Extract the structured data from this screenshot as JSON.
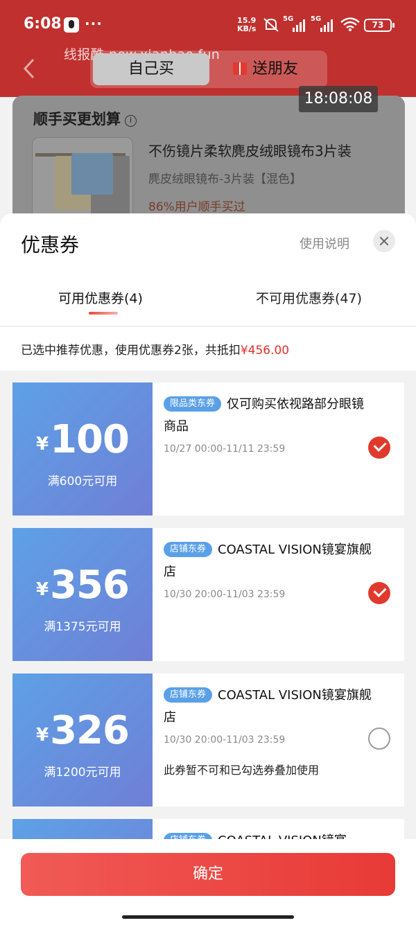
{
  "status_bar": {
    "time": "6:08",
    "more": "···",
    "net_speed_value": "15.9",
    "net_speed_unit": "KB/s",
    "sim1": "5G",
    "sim2": "5G",
    "battery": "73"
  },
  "watermark": "线报酷-new.xianbao.fun",
  "overlay_time": "18:08:08",
  "header": {
    "buy_self": "自己买",
    "send_friend": "送朋友"
  },
  "bg_card": {
    "title": "顺手买更划算",
    "info": "i",
    "product_name": "不伤镜片柔软麂皮绒眼镜布3片装",
    "product_variant": "麂皮绒眼镜布-3片装【混色】",
    "product_stat": "86%用户顺手买过"
  },
  "sheet": {
    "title": "优惠券",
    "usage_link": "使用说明",
    "tab_available": "可用优惠券(4)",
    "tab_unavailable": "不可用优惠券(47)",
    "summary_prefix": "已选中推荐优惠，使用优惠券2张，共抵扣",
    "summary_amount": "¥456.00"
  },
  "coupons": [
    {
      "yen": "¥",
      "amount": "100",
      "threshold": "满600元可用",
      "tag": "限品类东券",
      "desc": "仅可购买依视路部分眼镜商品",
      "period": "10/27 00:00-11/11 23:59",
      "note": "",
      "selected": true
    },
    {
      "yen": "¥",
      "amount": "356",
      "threshold": "满1375元可用",
      "tag": "店铺东券",
      "desc": "COASTAL VISION镜宴旗舰店",
      "period": "10/30 20:00-11/03 23:59",
      "note": "",
      "selected": true
    },
    {
      "yen": "¥",
      "amount": "326",
      "threshold": "满1200元可用",
      "tag": "店铺东券",
      "desc": "COASTAL VISION镜宴旗舰店",
      "period": "10/30 20:00-11/03 23:59",
      "note": "此券暂不可和已勾选券叠加使用",
      "selected": false
    },
    {
      "yen": "¥",
      "amount": "",
      "threshold": "",
      "tag": "店铺东券",
      "desc": "COASTAL VISION镜宴",
      "period": "",
      "note": "",
      "selected": false
    }
  ],
  "confirm_label": "确定",
  "colors": {
    "header_red": "#c0302f",
    "accent_red": "#e0322a",
    "coupon_blue": "#6f7fd6",
    "tag_blue": "#5aa0e8"
  }
}
